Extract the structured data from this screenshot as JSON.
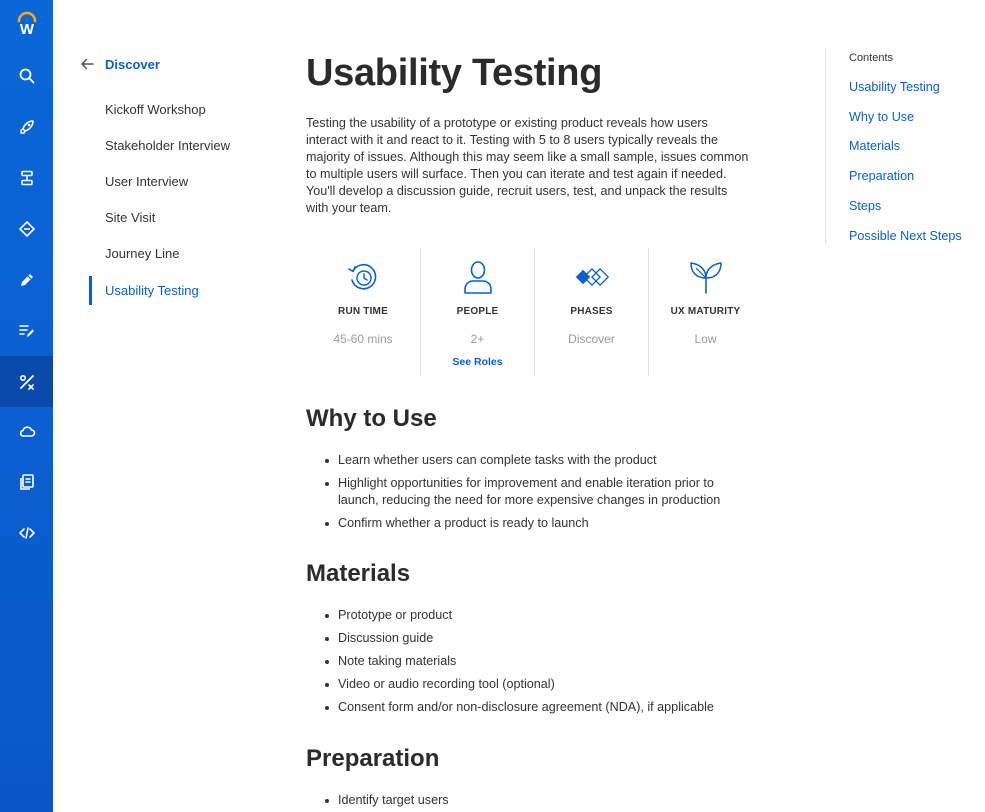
{
  "brand": {
    "logo_letter": "W",
    "accent": "#0a5fd0",
    "rail_color": "#0a67d6"
  },
  "rail": {
    "icons": [
      {
        "name": "search-icon"
      },
      {
        "name": "rocket-icon"
      },
      {
        "name": "stack-icon"
      },
      {
        "name": "diamond-code-icon"
      },
      {
        "name": "pencil-icon"
      },
      {
        "name": "list-edit-icon"
      },
      {
        "name": "tools-icon",
        "active": true
      },
      {
        "name": "cloud-icon"
      },
      {
        "name": "document-icon"
      },
      {
        "name": "code-icon"
      }
    ]
  },
  "subnav": {
    "back_label": "Discover",
    "items": [
      {
        "label": "Kickoff Workshop"
      },
      {
        "label": "Stakeholder Interview"
      },
      {
        "label": "User Interview"
      },
      {
        "label": "Site Visit"
      },
      {
        "label": "Journey Line"
      },
      {
        "label": "Usability Testing",
        "active": true
      }
    ]
  },
  "main": {
    "title": "Usability Testing",
    "intro": "Testing the usability of a prototype or existing product reveals how users interact with it and react to it. Testing with 5 to 8 users typically reveals the majority of issues. Although this may seem like a small sample, issues common to multiple users will surface. Then you can iterate and test again if needed. You'll develop a discussion guide, recruit users, test, and unpack the results with your team.",
    "stats": [
      {
        "icon": "clock-refresh-icon",
        "label": "RUN TIME",
        "value": "45-60 mins"
      },
      {
        "icon": "person-icon",
        "label": "PEOPLE",
        "value": "2+",
        "link": "See Roles"
      },
      {
        "icon": "phases-diamond-icon",
        "label": "PHASES",
        "value": "Discover"
      },
      {
        "icon": "sprout-icon",
        "label": "UX MATURITY",
        "value": "Low"
      }
    ],
    "why": {
      "heading": "Why to Use",
      "items": [
        "Learn whether users can complete tasks with the product",
        "Highlight opportunities for improvement and enable iteration prior to launch, reducing the need for more expensive changes in production",
        "Confirm whether a product is ready to launch"
      ]
    },
    "materials": {
      "heading": "Materials",
      "items": [
        "Prototype or product",
        "Discussion guide",
        "Note taking materials",
        "Video or audio recording tool (optional)",
        "Consent form and/or non-disclosure agreement (NDA), if applicable"
      ]
    },
    "preparation": {
      "heading": "Preparation",
      "items": [
        "Identify target users"
      ]
    }
  },
  "toc": {
    "title": "Contents",
    "items": [
      "Usability Testing",
      "Why to Use",
      "Materials",
      "Preparation",
      "Steps",
      "Possible Next Steps"
    ]
  }
}
